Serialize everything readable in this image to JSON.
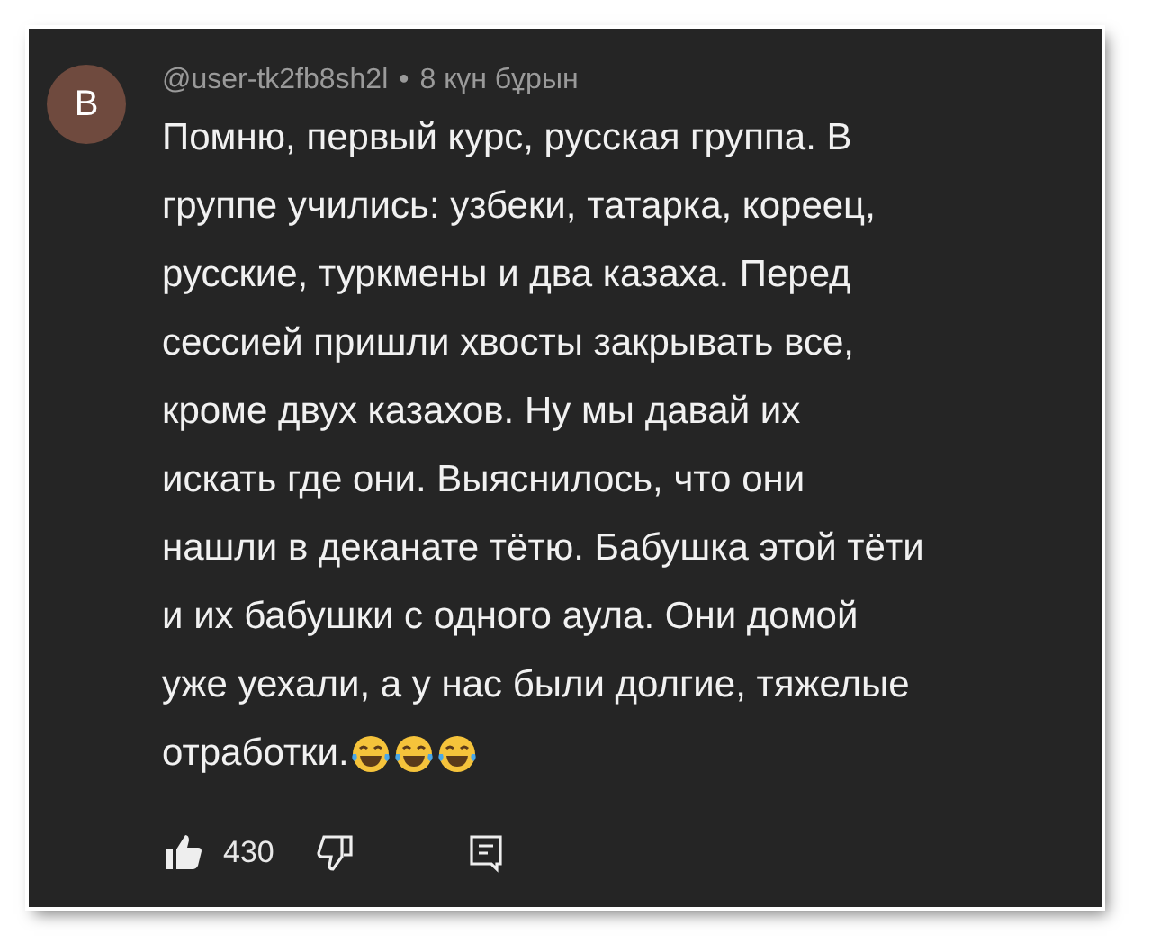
{
  "comment": {
    "avatar_letter": "В",
    "author": "@user-tk2fb8sh2l",
    "separator": "•",
    "time": "8 күн бұрын",
    "text_lines": [
      "Помню, первый курс, русская группа. В",
      "группе учились: узбеки, татарка, кореец,",
      "русские, туркмены и два казаха. Перед",
      "сессией пришли хвосты закрывать все,",
      "кроме двух казахов. Ну мы давай их",
      "искать где они. Выяснилось, что они",
      "нашли в деканате тётю. Бабушка этой тёти",
      "и их бабушки с одного аула. Они домой",
      "уже уехали, а у нас были долгие, тяжелые",
      "отработки."
    ],
    "emojis": [
      {
        "kind": "tears-of-joy"
      },
      {
        "kind": "tears-of-joy"
      },
      {
        "kind": "tears-of-joy"
      }
    ],
    "likes": "430",
    "liked": true
  }
}
